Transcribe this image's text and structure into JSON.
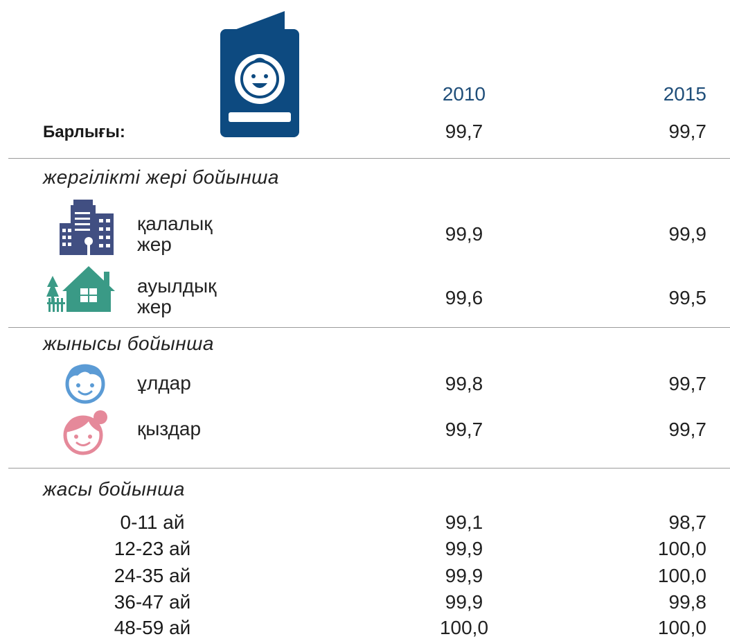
{
  "header": {
    "year_2010": "2010",
    "year_2015": "2015"
  },
  "total": {
    "label": "Барлығы:",
    "v2010": "99,7",
    "v2015": "99,7"
  },
  "residence": {
    "title": "жергілікті жері бойынша",
    "urban": {
      "label_line1": "қалалық",
      "label_line2": "жер",
      "v2010": "99,9",
      "v2015": "99,9"
    },
    "rural": {
      "label_line1": "ауылдық",
      "label_line2": "жер",
      "v2010": "99,6",
      "v2015": "99,5"
    }
  },
  "sex": {
    "title": "жынысы бойынша",
    "boys": {
      "label": "ұлдар",
      "v2010": "99,8",
      "v2015": "99,7"
    },
    "girls": {
      "label": "қыздар",
      "v2010": "99,7",
      "v2015": "99,7"
    }
  },
  "age": {
    "title": "жасы бойынша",
    "rows": [
      {
        "label": "0-11 ай",
        "v2010": "99,1",
        "v2015": "98,7"
      },
      {
        "label": "12-23 ай",
        "v2010": "99,9",
        "v2015": "100,0"
      },
      {
        "label": "24-35 ай",
        "v2010": "99,9",
        "v2015": "100,0"
      },
      {
        "label": "36-47 ай",
        "v2010": "99,9",
        "v2015": "99,8"
      },
      {
        "label": "48-59 ай",
        "v2010": "100,0",
        "v2015": "100,0"
      }
    ]
  },
  "icons": {
    "certificate": "birth-certificate-icon",
    "urban": "city-buildings-icon",
    "rural": "village-house-icon",
    "boy": "boy-face-icon",
    "girl": "girl-face-icon"
  },
  "colors": {
    "year_blue": "#1f4e79",
    "certificate_blue": "#0d4a80",
    "urban_navy": "#414f82",
    "rural_green": "#3a9a86",
    "boy_blue": "#5b9bd5",
    "girl_pink": "#e5899a"
  }
}
